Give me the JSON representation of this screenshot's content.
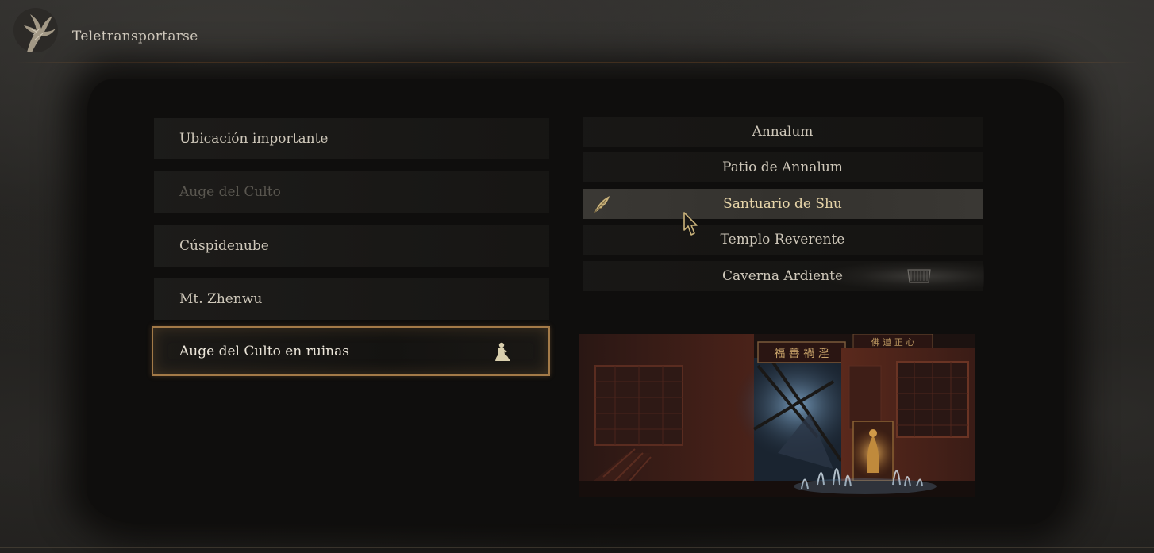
{
  "header": {
    "title": "Teletransportarse",
    "emblem_icon": "phoenix-feather-emblem-icon"
  },
  "categories": {
    "items": [
      {
        "label": "Ubicación importante",
        "state": "normal"
      },
      {
        "label": "Auge del Culto",
        "state": "disabled"
      },
      {
        "label": "Cúspidenube",
        "state": "normal"
      },
      {
        "label": "Mt. Zhenwu",
        "state": "normal"
      },
      {
        "label": "Auge del Culto en ruinas",
        "state": "selected",
        "icon": "praying-statue-icon"
      }
    ]
  },
  "locations": {
    "items": [
      {
        "label": "Annalum",
        "state": "normal"
      },
      {
        "label": "Patio de Annalum",
        "state": "normal"
      },
      {
        "label": "Santuario de Shu",
        "state": "selected",
        "icon": "golden-feather-icon"
      },
      {
        "label": "Templo Reverente",
        "state": "normal"
      },
      {
        "label": "Caverna Ardiente",
        "state": "normal"
      }
    ]
  },
  "preview": {
    "signboard_text_1": "福 善 禍 淫",
    "signboard_text_2": "佛 道 正 心"
  },
  "colors": {
    "accent_gold": "#a37a48",
    "selected_text": "#e6d4a8",
    "text": "#cfc8ba",
    "dim_text": "#5a5750"
  }
}
